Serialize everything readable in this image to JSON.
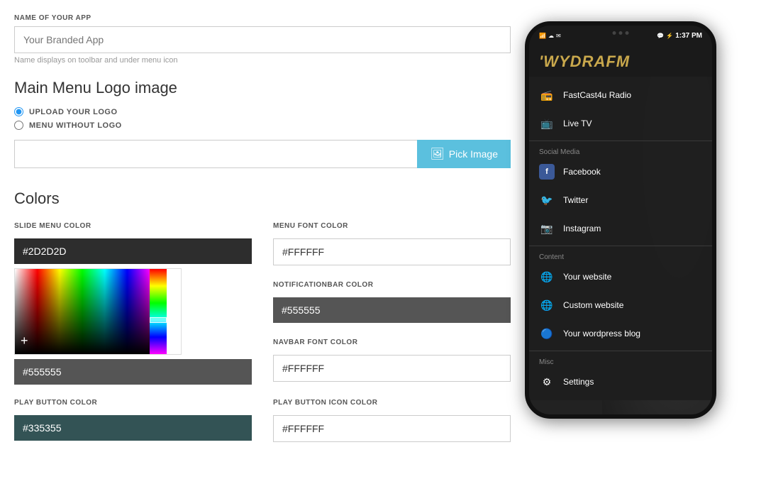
{
  "form": {
    "app_name_label": "NAME OF YOUR APP",
    "app_name_placeholder": "Your Branded App",
    "app_name_hint": "Name displays on toolbar and under menu icon",
    "logo_section_title": "Main Menu Logo image",
    "radio_upload": "UPLOAD YOUR LOGO",
    "radio_without": "MENU WITHOUT LOGO",
    "pick_image_btn": "Pick Image",
    "colors_title": "Colors",
    "slide_menu_label": "SLIDE MENU COLOR",
    "slide_menu_value": "#2D2D2D",
    "menu_font_label": "MENU FONT COLOR",
    "menu_font_value": "#FFFFFF",
    "notif_label": "NOTIFICATIONBAR COLOR",
    "notif_value": "#555555",
    "navbar_label": "NAVBAR FONT COLOR",
    "navbar_value": "#FFFFFF",
    "play_btn_label": "PLAY BUTTON COLOR",
    "play_btn_value": "#335355",
    "play_icon_label": "PLAY BUTTON ICON COLOR",
    "play_icon_value": "#FFFFFF"
  },
  "phone": {
    "status_time": "1:37 PM",
    "app_title": "'WYDRAFM",
    "menu_items_main": [
      {
        "label": "FastCast4u Radio",
        "icon": "radio"
      },
      {
        "label": "Live TV",
        "icon": "tv"
      }
    ],
    "social_section": "Social Media",
    "social_items": [
      {
        "label": "Facebook",
        "icon": "facebook"
      },
      {
        "label": "Twitter",
        "icon": "twitter"
      },
      {
        "label": "Instagram",
        "icon": "instagram"
      }
    ],
    "content_section": "Content",
    "content_items": [
      {
        "label": "Your website",
        "icon": "globe"
      },
      {
        "label": "Custom website",
        "icon": "globe"
      },
      {
        "label": "Your wordpress blog",
        "icon": "wordpress"
      }
    ],
    "misc_section": "Misc",
    "misc_items": [
      {
        "label": "Settings",
        "icon": "gear"
      }
    ]
  }
}
